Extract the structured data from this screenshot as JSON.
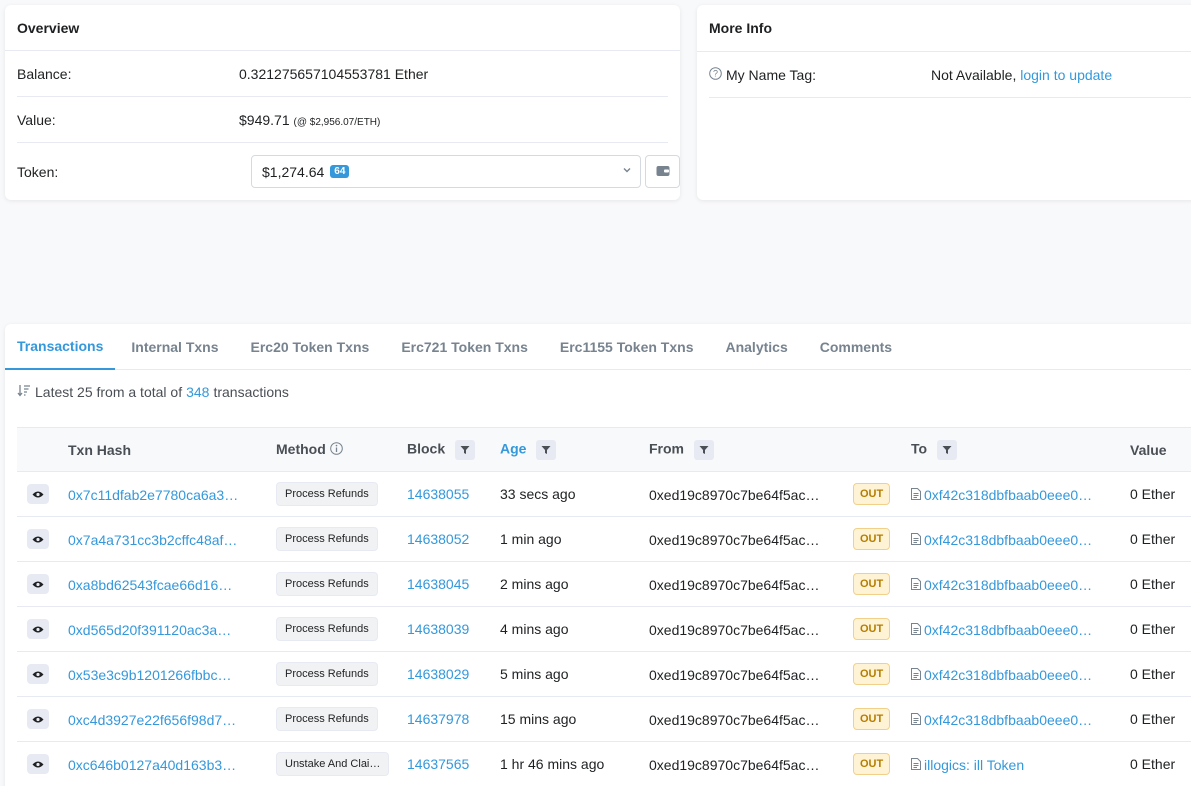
{
  "overview": {
    "title": "Overview",
    "balance_label": "Balance:",
    "balance_value": "0.321275657104553781 Ether",
    "value_label": "Value:",
    "value_usd": "$949.71",
    "value_rate": "(@ $2,956.07/ETH)",
    "token_label": "Token:",
    "token_value": "$1,274.64",
    "token_count": "64"
  },
  "more_info": {
    "title": "More Info",
    "name_tag_label": "My Name Tag:",
    "name_tag_value": "Not Available,",
    "name_tag_link": "login to update"
  },
  "tabs": [
    {
      "label": "Transactions",
      "active": true
    },
    {
      "label": "Internal Txns"
    },
    {
      "label": "Erc20 Token Txns"
    },
    {
      "label": "Erc721 Token Txns"
    },
    {
      "label": "Erc1155 Token Txns"
    },
    {
      "label": "Analytics"
    },
    {
      "label": "Comments"
    }
  ],
  "summary": {
    "prefix": "Latest 25 from a total of",
    "count": "348",
    "suffix": "transactions"
  },
  "table": {
    "headers": {
      "txn_hash": "Txn Hash",
      "method": "Method",
      "block": "Block",
      "age": "Age",
      "from": "From",
      "to": "To",
      "value": "Value"
    },
    "rows": [
      {
        "hash": "0x7c11dfab2e7780ca6a3…",
        "method": "Process Refunds",
        "block": "14638055",
        "age": "33 secs ago",
        "from": "0xed19c8970c7be64f5ac…",
        "dir": "OUT",
        "to": "0xf42c318dbfbaab0eee0…",
        "value": "0 Ether"
      },
      {
        "hash": "0x7a4a731cc3b2cffc48af…",
        "method": "Process Refunds",
        "block": "14638052",
        "age": "1 min ago",
        "from": "0xed19c8970c7be64f5ac…",
        "dir": "OUT",
        "to": "0xf42c318dbfbaab0eee0…",
        "value": "0 Ether"
      },
      {
        "hash": "0xa8bd62543fcae66d16…",
        "method": "Process Refunds",
        "block": "14638045",
        "age": "2 mins ago",
        "from": "0xed19c8970c7be64f5ac…",
        "dir": "OUT",
        "to": "0xf42c318dbfbaab0eee0…",
        "value": "0 Ether"
      },
      {
        "hash": "0xd565d20f391120ac3a…",
        "method": "Process Refunds",
        "block": "14638039",
        "age": "4 mins ago",
        "from": "0xed19c8970c7be64f5ac…",
        "dir": "OUT",
        "to": "0xf42c318dbfbaab0eee0…",
        "value": "0 Ether"
      },
      {
        "hash": "0x53e3c9b1201266fbbc…",
        "method": "Process Refunds",
        "block": "14638029",
        "age": "5 mins ago",
        "from": "0xed19c8970c7be64f5ac…",
        "dir": "OUT",
        "to": "0xf42c318dbfbaab0eee0…",
        "value": "0 Ether"
      },
      {
        "hash": "0xc4d3927e22f656f98d7…",
        "method": "Process Refunds",
        "block": "14637978",
        "age": "15 mins ago",
        "from": "0xed19c8970c7be64f5ac…",
        "dir": "OUT",
        "to": "0xf42c318dbfbaab0eee0…",
        "value": "0 Ether"
      },
      {
        "hash": "0xc646b0127a40d163b3…",
        "method": "Unstake And Clai…",
        "block": "14637565",
        "age": "1 hr 46 mins ago",
        "from": "0xed19c8970c7be64f5ac…",
        "dir": "OUT",
        "to": "illogics: ill Token",
        "value": "0 Ether"
      }
    ]
  },
  "colors": {
    "accent": "#3498db",
    "out_badge_bg": "#fff3d6",
    "out_badge_text": "#b47d00"
  }
}
